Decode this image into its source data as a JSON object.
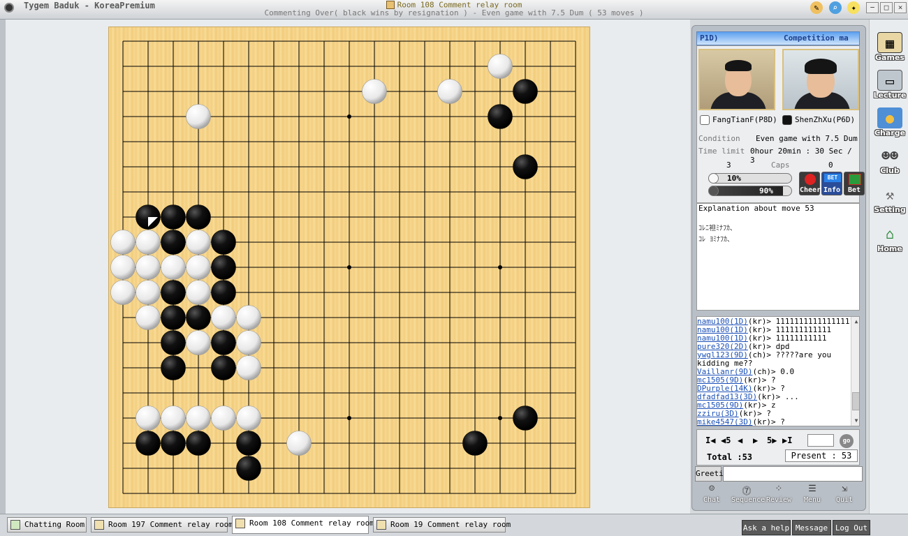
{
  "app": {
    "title": "Tygem Baduk - KoreaPremium",
    "room_title": "Room 108 Comment relay room",
    "subtitle": "Commenting Over( black wins by resignation ) - Even game with 7.5 Dum  ( 53 moves )"
  },
  "players": {
    "header_left": "P1D)",
    "header_right": "Competition ma",
    "white": "FangTianF(P8D)",
    "black": "ShenZhXu(P6D)"
  },
  "game_info": {
    "condition_label": "Condition",
    "condition_value": "Even game with 7.5 Dum",
    "time_label": "Time limit",
    "time_value": "0hour 20min : 30 Sec / 3",
    "caps_left": "3",
    "caps_label": "Caps",
    "caps_right": "0",
    "white_percent": "10%",
    "black_percent": "90%",
    "cheer_label": "Cheer",
    "info_label": "Info",
    "bet_label": "Bet",
    "bet_badge": "BET"
  },
  "commentary": {
    "title": "Explanation about move 53",
    "lines": [
      "ｺﾚﾆ袒ﾐﾅﾌｶ､",
      "ｺﾚ ﾖﾐﾅﾌｶ､"
    ]
  },
  "chat": [
    {
      "user": "namu100(1D)",
      "text": "(kr)> 11111111111111111"
    },
    {
      "user": "namu100(1D)",
      "text": "(kr)> 111111111111"
    },
    {
      "user": "namu100(1D)",
      "text": "(kr)> 11111111111"
    },
    {
      "user": "pure320(2D)",
      "text": "(kr)> dpd"
    },
    {
      "user": "ywgl123(9D)",
      "text": "(ch)> ?????are you"
    },
    {
      "user": "",
      "text": "kidding me??"
    },
    {
      "user": "Vaillanr(9D)",
      "text": "(ch)> 0.0"
    },
    {
      "user": "mc1505(9D)",
      "text": "(kr)> ?"
    },
    {
      "user": "DPurple(14K)",
      "text": "(kr)> ?"
    },
    {
      "user": "dfadfad13(3D)",
      "text": "(kr)> ..."
    },
    {
      "user": "mc1505(9D)",
      "text": "(kr)> z"
    },
    {
      "user": "zziru(3D)",
      "text": "(kr)> ?"
    },
    {
      "user": "mike4547(3D)",
      "text": "(kr)> ?"
    }
  ],
  "navigation": {
    "first": "I◀",
    "back5": "◀5",
    "prev": "◀",
    "next": "▶",
    "fwd5": "5▶",
    "last": "▶I",
    "go_label": "go",
    "total": "Total :53",
    "present": "Present : 53"
  },
  "greeting_label": "Greeting",
  "bottom_tools": [
    "Chat",
    "Sequence",
    "Review",
    "Menu",
    "Quit"
  ],
  "sidebar": [
    "Games",
    "Lecture",
    "Charge",
    "Club",
    "Setting",
    "Home"
  ],
  "tabs": [
    "Chatting Room",
    "Room 197 Comment relay room",
    "Room 108 Comment relay room",
    "Room 19 Comment relay room"
  ],
  "bottom_buttons": [
    "Ask a help",
    "Message",
    "Log Out"
  ],
  "board": {
    "size": 19,
    "stones": [
      {
        "col": 15,
        "row": 1,
        "color": "white"
      },
      {
        "col": 10,
        "row": 2,
        "color": "white"
      },
      {
        "col": 13,
        "row": 2,
        "color": "white"
      },
      {
        "col": 16,
        "row": 2,
        "color": "black"
      },
      {
        "col": 3,
        "row": 3,
        "color": "white"
      },
      {
        "col": 15,
        "row": 3,
        "color": "black"
      },
      {
        "col": 16,
        "row": 5,
        "color": "black"
      },
      {
        "col": 1,
        "row": 7,
        "color": "black"
      },
      {
        "col": 2,
        "row": 7,
        "color": "black"
      },
      {
        "col": 3,
        "row": 7,
        "color": "black"
      },
      {
        "col": 0,
        "row": 8,
        "color": "white"
      },
      {
        "col": 1,
        "row": 8,
        "color": "white"
      },
      {
        "col": 2,
        "row": 8,
        "color": "black"
      },
      {
        "col": 3,
        "row": 8,
        "color": "white"
      },
      {
        "col": 4,
        "row": 8,
        "color": "black"
      },
      {
        "col": 0,
        "row": 9,
        "color": "white"
      },
      {
        "col": 1,
        "row": 9,
        "color": "white"
      },
      {
        "col": 2,
        "row": 9,
        "color": "white"
      },
      {
        "col": 3,
        "row": 9,
        "color": "white"
      },
      {
        "col": 4,
        "row": 9,
        "color": "black"
      },
      {
        "col": 0,
        "row": 10,
        "color": "white"
      },
      {
        "col": 1,
        "row": 10,
        "color": "white"
      },
      {
        "col": 2,
        "row": 10,
        "color": "black"
      },
      {
        "col": 3,
        "row": 10,
        "color": "white"
      },
      {
        "col": 4,
        "row": 10,
        "color": "black"
      },
      {
        "col": 1,
        "row": 11,
        "color": "white"
      },
      {
        "col": 2,
        "row": 11,
        "color": "black"
      },
      {
        "col": 3,
        "row": 11,
        "color": "black"
      },
      {
        "col": 4,
        "row": 11,
        "color": "white"
      },
      {
        "col": 5,
        "row": 11,
        "color": "white"
      },
      {
        "col": 2,
        "row": 12,
        "color": "black"
      },
      {
        "col": 3,
        "row": 12,
        "color": "white"
      },
      {
        "col": 4,
        "row": 12,
        "color": "black"
      },
      {
        "col": 5,
        "row": 12,
        "color": "white"
      },
      {
        "col": 2,
        "row": 13,
        "color": "black"
      },
      {
        "col": 4,
        "row": 13,
        "color": "black"
      },
      {
        "col": 5,
        "row": 13,
        "color": "white"
      },
      {
        "col": 1,
        "row": 15,
        "color": "white"
      },
      {
        "col": 2,
        "row": 15,
        "color": "white"
      },
      {
        "col": 3,
        "row": 15,
        "color": "white"
      },
      {
        "col": 4,
        "row": 15,
        "color": "white"
      },
      {
        "col": 5,
        "row": 15,
        "color": "white"
      },
      {
        "col": 16,
        "row": 15,
        "color": "black"
      },
      {
        "col": 1,
        "row": 16,
        "color": "black"
      },
      {
        "col": 2,
        "row": 16,
        "color": "black"
      },
      {
        "col": 3,
        "row": 16,
        "color": "black"
      },
      {
        "col": 5,
        "row": 16,
        "color": "black"
      },
      {
        "col": 7,
        "row": 16,
        "color": "white"
      },
      {
        "col": 14,
        "row": 16,
        "color": "black"
      },
      {
        "col": 5,
        "row": 17,
        "color": "black"
      }
    ],
    "last_move": {
      "col": 1,
      "row": 7
    },
    "hoshi": [
      [
        3,
        3
      ],
      [
        9,
        3
      ],
      [
        15,
        3
      ],
      [
        3,
        9
      ],
      [
        9,
        9
      ],
      [
        15,
        9
      ],
      [
        3,
        15
      ],
      [
        9,
        15
      ],
      [
        15,
        15
      ]
    ]
  }
}
